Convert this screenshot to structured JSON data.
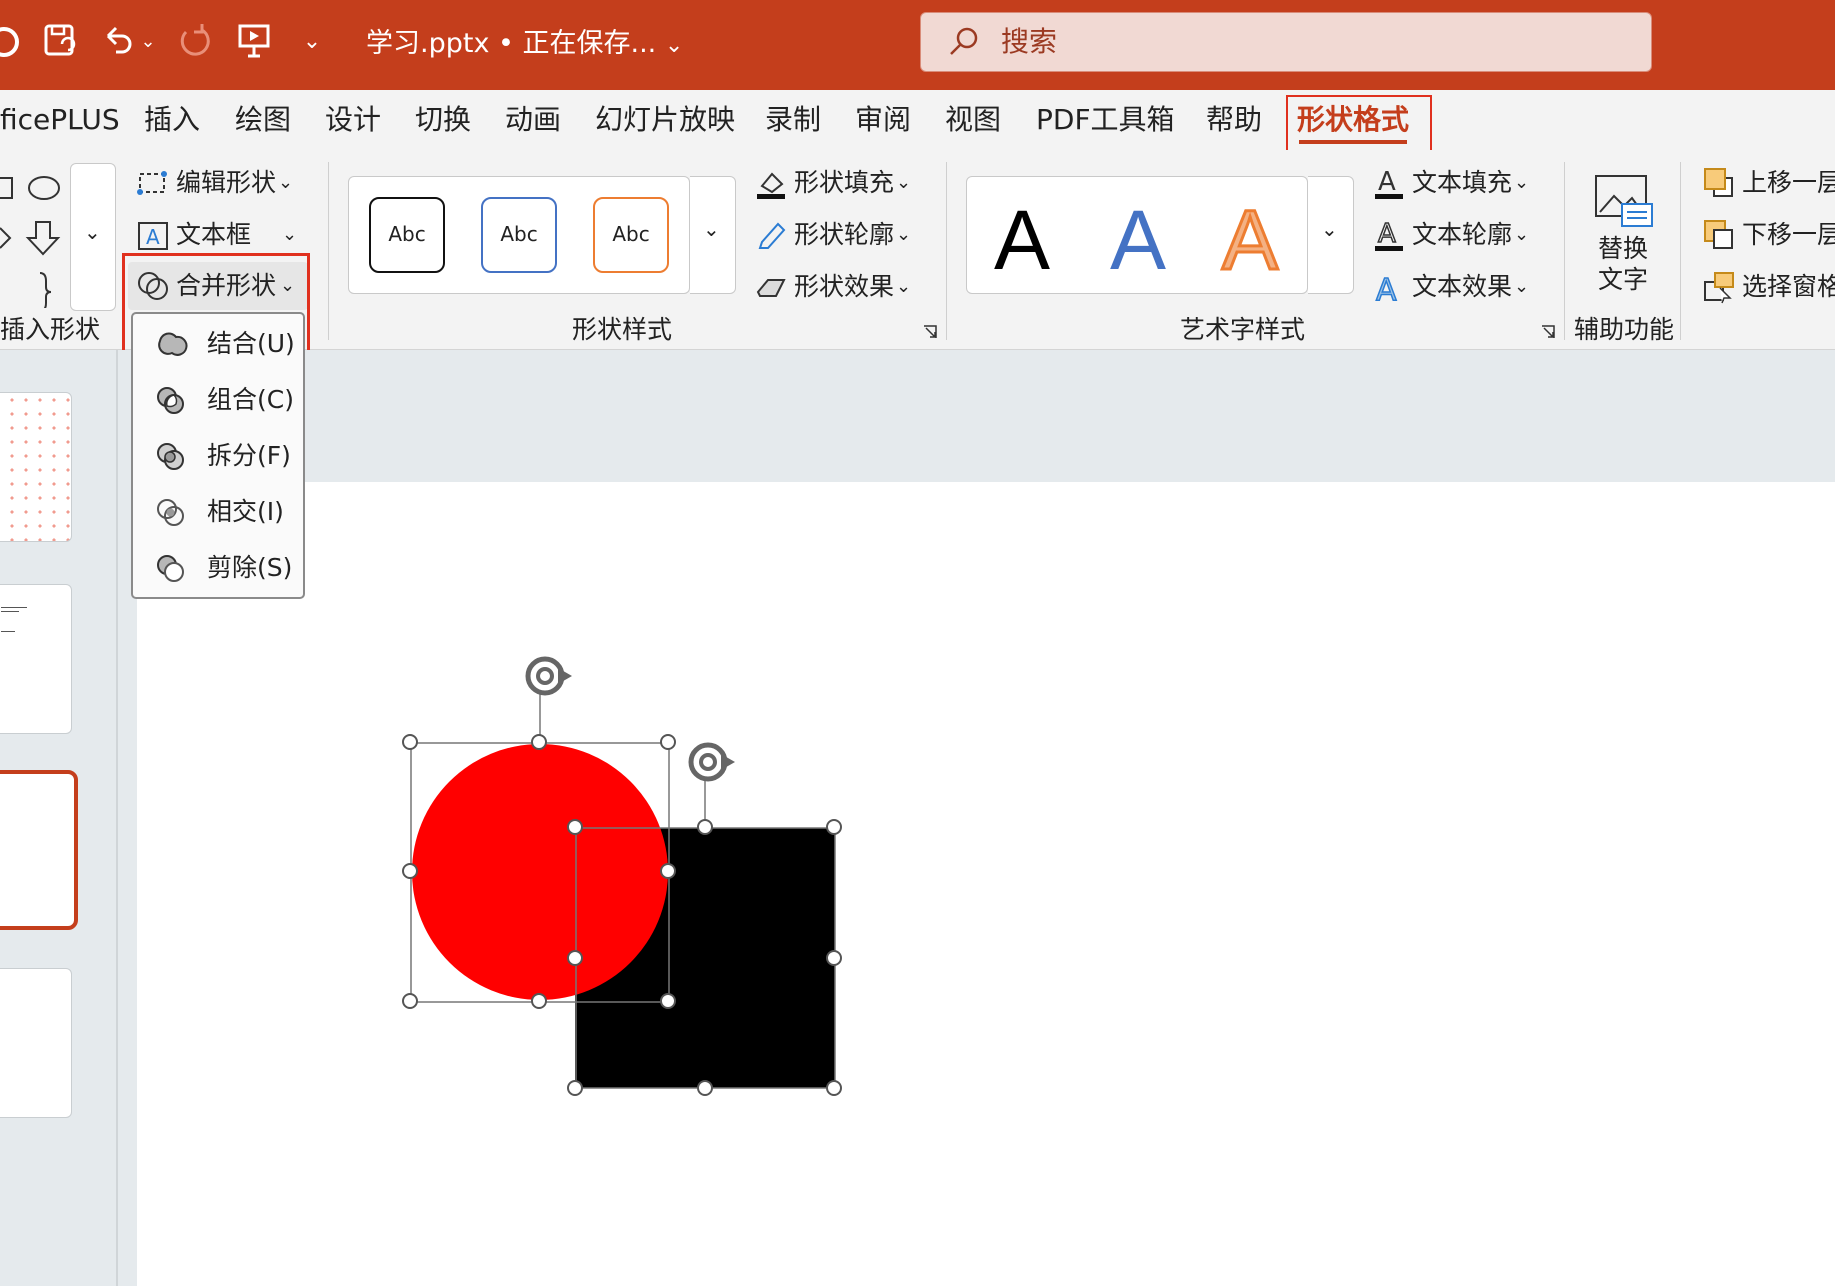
{
  "titlebar": {
    "doc_title": "学习.pptx • 正在保存...",
    "search_placeholder": "搜索"
  },
  "tabs": {
    "officeplus": "ficePLUS",
    "insert": "插入",
    "draw": "绘图",
    "design": "设计",
    "transitions": "切换",
    "animations": "动画",
    "slideshow": "幻灯片放映",
    "record": "录制",
    "review": "审阅",
    "view": "视图",
    "pdf": "PDF工具箱",
    "help": "帮助",
    "shape_format": "形状格式"
  },
  "ribbon": {
    "insert_shapes": {
      "edit_shape": "编辑形状",
      "text_box": "文本框",
      "merge_shapes": "合并形状",
      "label": "插入形状"
    },
    "shape_styles": {
      "abc1": "Abc",
      "abc2": "Abc",
      "abc3": "Abc",
      "fill": "形状填充",
      "outline": "形状轮廓",
      "effects": "形状效果",
      "label": "形状样式"
    },
    "wordart": {
      "a1": "A",
      "a2": "A",
      "a3": "A",
      "text_fill": "文本填充",
      "text_outline": "文本轮廓",
      "text_effects": "文本效果",
      "label": "艺术字样式"
    },
    "accessibility": {
      "alt_text_line1": "替换",
      "alt_text_line2": "文字",
      "label": "辅助功能"
    },
    "arrange": {
      "bring_forward": "上移一层",
      "send_backward": "下移一层",
      "selection_pane": "选择窗格"
    }
  },
  "merge_menu": {
    "items": [
      {
        "label": "结合(U)",
        "icon": "union-icon"
      },
      {
        "label": "组合(C)",
        "icon": "combine-icon"
      },
      {
        "label": "拆分(F)",
        "icon": "fragment-icon"
      },
      {
        "label": "相交(I)",
        "icon": "intersect-icon"
      },
      {
        "label": "剪除(S)",
        "icon": "subtract-icon"
      }
    ]
  },
  "colors": {
    "brand": "#c43e1c",
    "highlight_box": "#e0301e",
    "circle_fill": "#ff0000",
    "square_fill": "#000000"
  }
}
